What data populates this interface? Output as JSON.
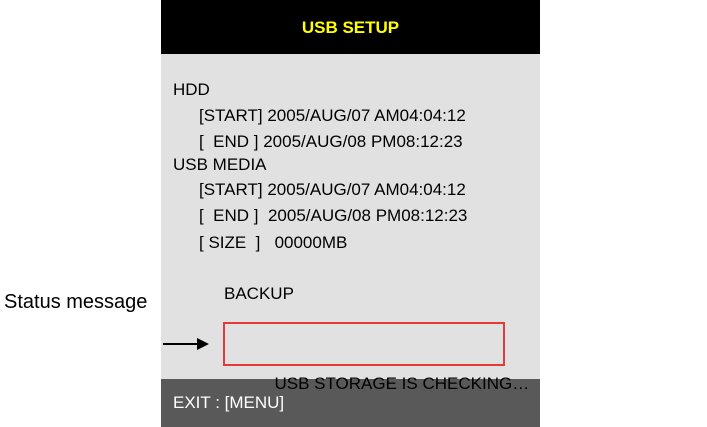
{
  "dialog": {
    "title": "USB SETUP",
    "hdd": {
      "label": "HDD",
      "start": "[START] 2005/AUG/07 AM04:04:12",
      "end": "[  END ] 2005/AUG/08 PM08:12:23"
    },
    "usb_media": {
      "label": "USB MEDIA",
      "start": "[START] 2005/AUG/07 AM04:04:12",
      "end": "[  END ]  2005/AUG/08 PM08:12:23",
      "size": "[ SIZE  ]   00000MB"
    },
    "backup_label": "BACKUP",
    "status_message": "USB STORAGE IS CHECKING…",
    "footer": "EXIT : [MENU]"
  },
  "annotation": {
    "label": "Status message"
  },
  "colors": {
    "title_bar": "#000000",
    "title_text": "#ffff00",
    "panel_bg": "#e1e1e1",
    "footer_bg": "#595959",
    "status_border": "#e53a3a"
  }
}
